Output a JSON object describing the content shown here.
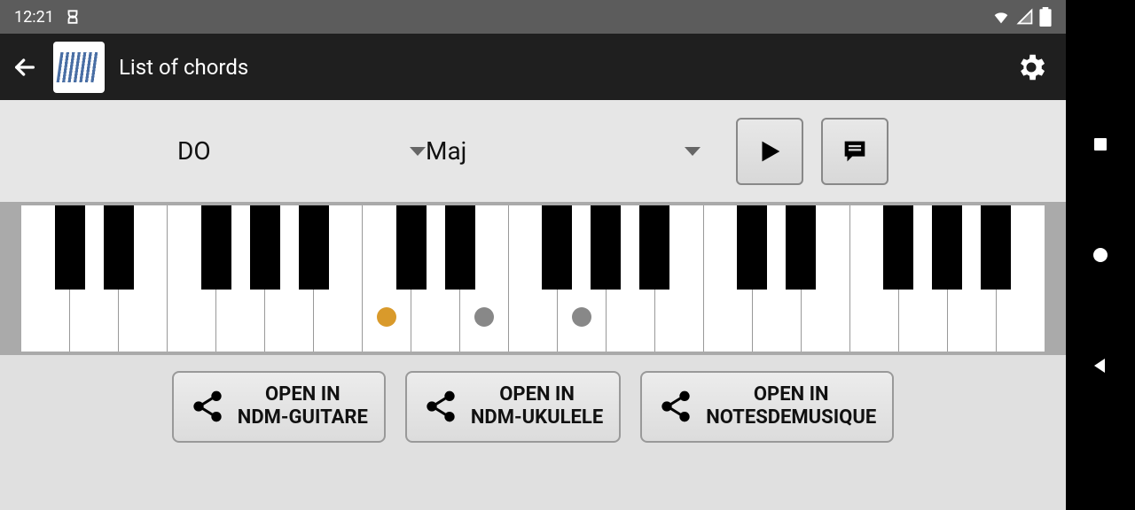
{
  "statusbar": {
    "time": "12:21"
  },
  "appbar": {
    "title": "List of chords"
  },
  "controls": {
    "note": "DO",
    "quality": "Maj"
  },
  "share": {
    "guitare": "OPEN IN\nNDM-GUITARE",
    "ukulele": "OPEN IN\nNDM-UKULELE",
    "notesdemusique": "OPEN IN\nNOTESDEMUSIQUE"
  },
  "piano": {
    "white_key_count": 21,
    "black_keys_after": [
      0,
      1,
      3,
      4,
      5,
      7,
      8,
      10,
      11,
      12,
      14,
      15,
      17,
      18,
      19
    ],
    "dots": [
      {
        "white_index": 7,
        "type": "root"
      },
      {
        "white_index": 9,
        "type": "other"
      },
      {
        "white_index": 11,
        "type": "other"
      }
    ]
  }
}
